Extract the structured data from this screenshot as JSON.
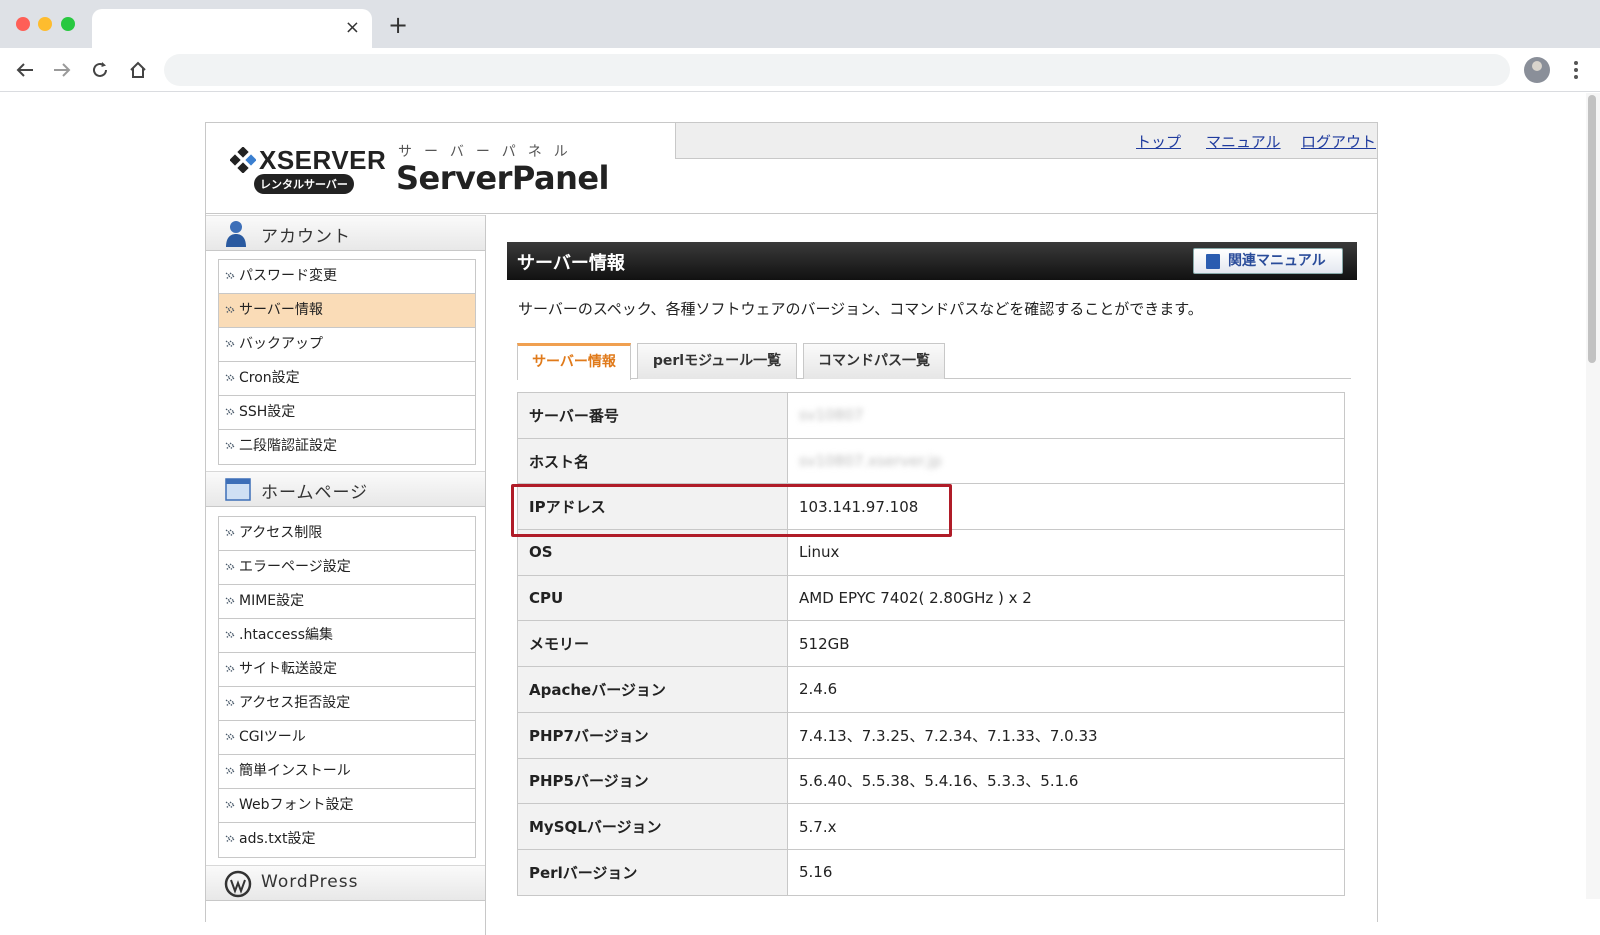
{
  "browser": {
    "tab_title": "",
    "tab_close": "×",
    "new_tab": "+",
    "address": ""
  },
  "header": {
    "logo_text": "XSERVER",
    "logo_badge": "レンタルサーバー",
    "panel_kana": "サーバーパネル",
    "panel_title": "ServerPanel",
    "nav": {
      "top": "トップ",
      "manual": "マニュアル",
      "logout": "ログアウト"
    }
  },
  "sidebar": {
    "account": {
      "title": "アカウント",
      "items": [
        "パスワード変更",
        "サーバー情報",
        "バックアップ",
        "Cron設定",
        "SSH設定",
        "二段階認証設定"
      ]
    },
    "homepage": {
      "title": "ホームページ",
      "items": [
        "アクセス制限",
        "エラーページ設定",
        "MIME設定",
        ".htaccess編集",
        "サイト転送設定",
        "アクセス拒否設定",
        "CGIツール",
        "簡単インストール",
        "Webフォント設定",
        "ads.txt設定"
      ]
    },
    "wordpress": {
      "title": "WordPress"
    }
  },
  "main": {
    "section_title": "サーバー情報",
    "manual_button": "関連マニュアル",
    "intro": "サーバーのスペック、各種ソフトウェアのバージョン、コマンドパスなどを確認することができます。",
    "tabs": [
      "サーバー情報",
      "perlモジュール一覧",
      "コマンドパス一覧"
    ],
    "rows": [
      {
        "key": "サーバー番号",
        "value": "sv10807"
      },
      {
        "key": "ホスト名",
        "value": "sv10807.xserver.jp"
      },
      {
        "key": "IPアドレス",
        "value": "103.141.97.108"
      },
      {
        "key": "OS",
        "value": "Linux"
      },
      {
        "key": "CPU",
        "value": "AMD EPYC 7402( 2.80GHz ) x 2"
      },
      {
        "key": "メモリー",
        "value": "512GB"
      },
      {
        "key": "Apacheバージョン",
        "value": "2.4.6"
      },
      {
        "key": "PHP7バージョン",
        "value": "7.4.13、7.3.25、7.2.34、7.1.33、7.0.33"
      },
      {
        "key": "PHP5バージョン",
        "value": "5.6.40、5.5.38、5.4.16、5.3.3、5.1.6"
      },
      {
        "key": "MySQLバージョン",
        "value": "5.7.x"
      },
      {
        "key": "Perlバージョン",
        "value": "5.16"
      }
    ]
  },
  "colors": {
    "active_menu": "#fadcb7",
    "active_tab_text": "#e07a1a",
    "highlight": "#b01c28",
    "link": "#1f3b9e"
  }
}
